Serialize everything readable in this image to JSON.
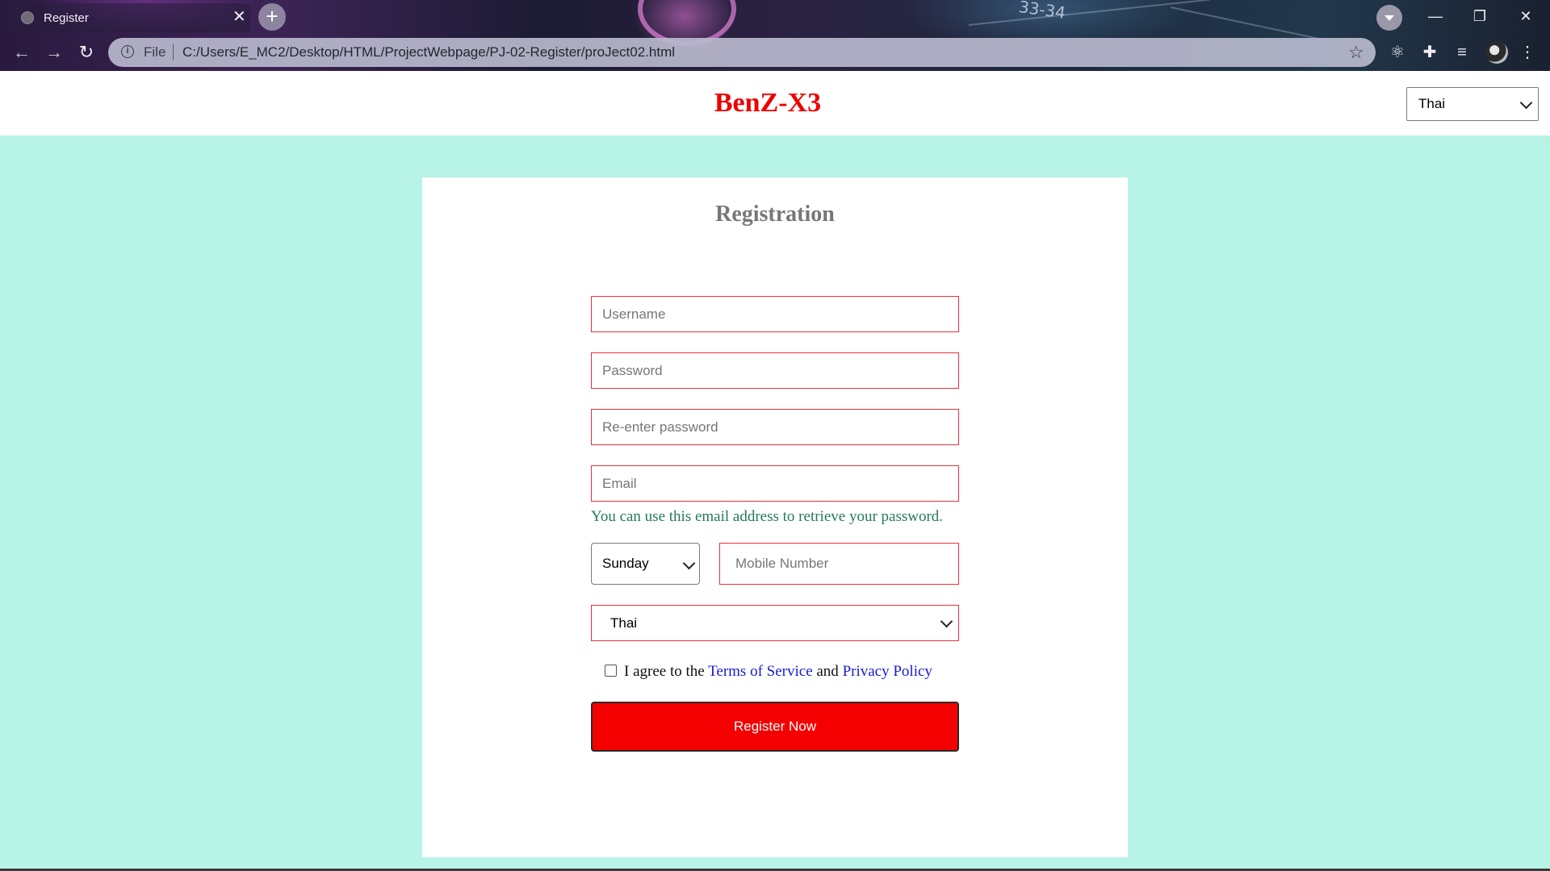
{
  "browser": {
    "tab_title": "Register",
    "tab_close": "✕",
    "new_tab": "+",
    "address_file_label": "File",
    "address_url": "C:/Users/E_MC2/Desktop/HTML/ProjectWebpage/PJ-02-Register/proJect02.html",
    "decor_number": "33-34"
  },
  "header": {
    "brand": "BenZ-X3",
    "language_selected": "Thai"
  },
  "form": {
    "title": "Registration",
    "username_placeholder": "Username",
    "password_placeholder": "Password",
    "reenter_placeholder": "Re-enter password",
    "email_placeholder": "Email",
    "email_hint": "You can use this email address to retrieve your password.",
    "day_selected": "Sunday",
    "mobile_placeholder": "Mobile Number",
    "country_selected": "Thai",
    "agree_prefix": "I agree to the ",
    "terms_link": "Terms of Service",
    "agree_mid": " and ",
    "privacy_link": "Privacy Policy",
    "agree_checked": false,
    "register_label": "Register Now"
  },
  "colors": {
    "page_background": "#b8f3e8",
    "brand_red": "#ee0000",
    "field_border": "#e8323c",
    "hint_green": "#237a5a",
    "link_blue": "#1a1ad6",
    "button_red": "#f50000"
  }
}
